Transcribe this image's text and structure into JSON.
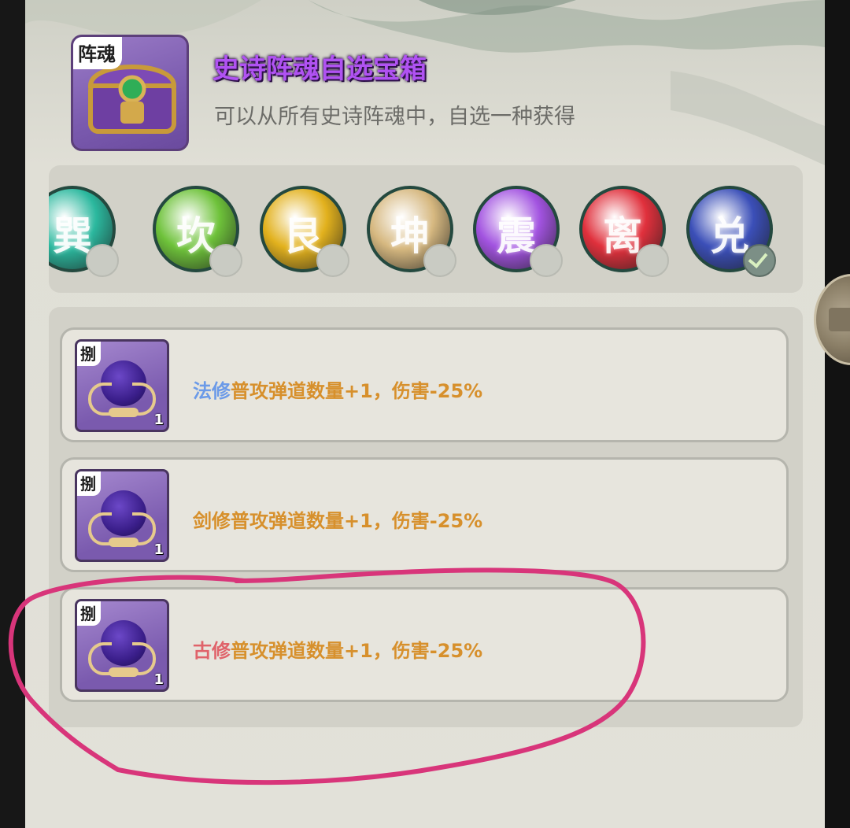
{
  "chest": {
    "tag": "阵魂",
    "title": "史诗阵魂自选宝箱",
    "description": "可以从所有史诗阵魂中，自选一种获得"
  },
  "orbs": [
    {
      "glyph": "巽",
      "color": "#2bb89e",
      "selected": false
    },
    {
      "glyph": "坎",
      "color": "#6ec23a",
      "selected": false
    },
    {
      "glyph": "艮",
      "color": "#e2b11d",
      "selected": false
    },
    {
      "glyph": "坤",
      "color": "#d6b880",
      "selected": false
    },
    {
      "glyph": "震",
      "color": "#a253e0",
      "selected": false
    },
    {
      "glyph": "离",
      "color": "#e0303c",
      "selected": false
    },
    {
      "glyph": "兑",
      "color": "#3b4fb8",
      "selected": true
    }
  ],
  "items": [
    {
      "tag": "捌",
      "count": "1",
      "prefix": "法修",
      "prefix_color": "#6b9ae8",
      "effect": "普攻弹道数量+1，伤害-25%"
    },
    {
      "tag": "捌",
      "count": "1",
      "prefix": "剑修",
      "prefix_color": "#d7902c",
      "effect": "普攻弹道数量+1，伤害-25%"
    },
    {
      "tag": "捌",
      "count": "1",
      "prefix": "古修",
      "prefix_color": "#e0636a",
      "effect": "普攻弹道数量+1，伤害-25%"
    }
  ],
  "colors": {
    "title_purple": "#b052f2",
    "effect_orange": "#d7902c",
    "annotation_pink": "#d8357a"
  }
}
